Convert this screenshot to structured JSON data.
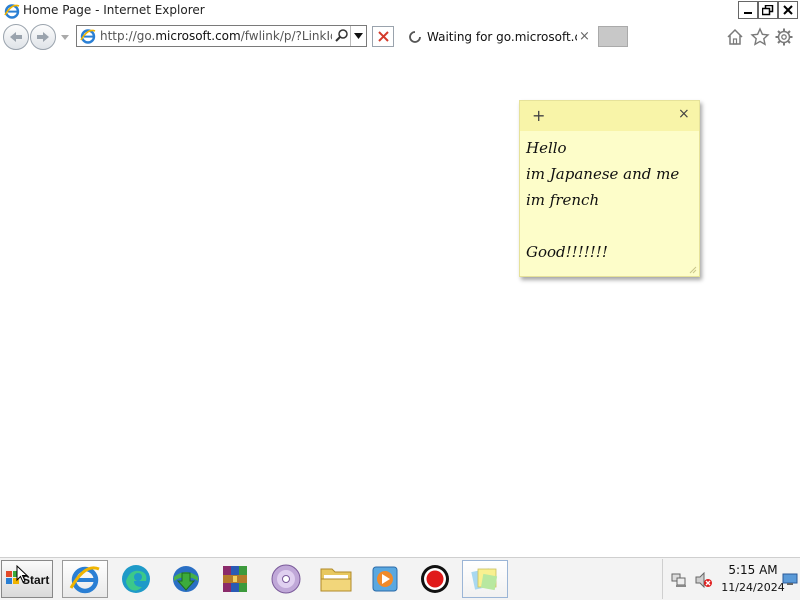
{
  "window": {
    "title": "Home Page - Internet Explorer",
    "icon": "ie-icon"
  },
  "navbar": {
    "back_icon": "back-arrow-icon",
    "forward_icon": "forward-arrow-icon",
    "address": {
      "prefix": "http://go.",
      "domain": "microsoft.com",
      "suffix": "/fwlink/p/?LinkId=",
      "search_icon": "search-icon",
      "dropdown_icon": "chevron-down-icon"
    },
    "stop_icon": "stop-x-icon",
    "tab": {
      "title": "Waiting for go.microsoft.c...",
      "close": "×"
    },
    "tools": [
      "home-icon",
      "favorites-star-icon",
      "gear-icon"
    ]
  },
  "sticky_note": {
    "add": "+",
    "close": "×",
    "lines": [
      "Hello",
      "im Japanese and me",
      "im french",
      "",
      "Good!!!!!!!"
    ],
    "background": "#fdfdc9"
  },
  "taskbar": {
    "start_label": "Start",
    "apps": [
      {
        "name": "internet-explorer-icon"
      },
      {
        "name": "edge-icon"
      },
      {
        "name": "download-manager-icon"
      },
      {
        "name": "winrar-icon"
      },
      {
        "name": "dvd-icon"
      },
      {
        "name": "file-explorer-icon"
      },
      {
        "name": "media-player-icon"
      },
      {
        "name": "record-icon"
      },
      {
        "name": "sticky-notes-icon"
      }
    ],
    "clock": {
      "time": "5:15 AM",
      "date": "11/24/2024"
    }
  }
}
